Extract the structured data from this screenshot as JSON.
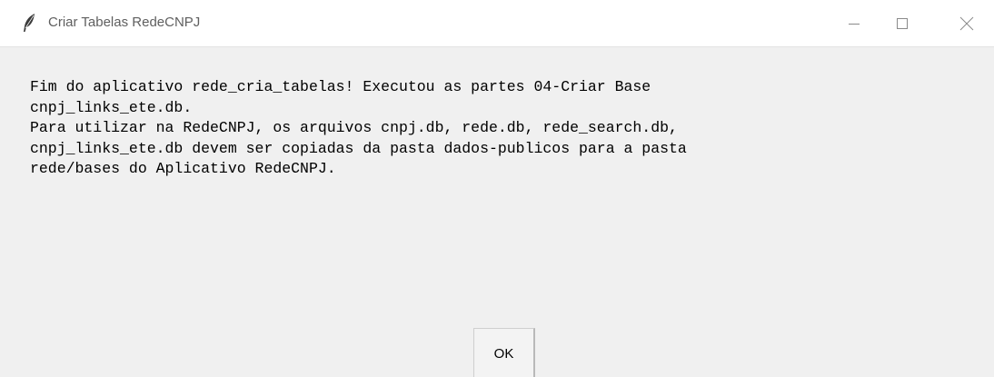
{
  "window": {
    "title": "Criar Tabelas RedeCNPJ",
    "icon": "feather-icon",
    "controls": {
      "minimize_icon": "minimize-icon",
      "maximize_icon": "maximize-icon",
      "close_icon": "close-icon"
    }
  },
  "dialog": {
    "message_lines": [
      "Fim do aplicativo rede_cria_tabelas! Executou as partes 04-Criar Base",
      "cnpj_links_ete.db.",
      "Para utilizar na RedeCNPJ, os arquivos cnpj.db, rede.db, rede_search.db,",
      "cnpj_links_ete.db devem ser copiadas da pasta dados-publicos para a pasta",
      "rede/bases do Aplicativo RedeCNPJ."
    ],
    "ok_label": "OK"
  },
  "colors": {
    "background": "#f0f0f0",
    "titlebar": "#ffffff",
    "title_text": "#5f5f5f",
    "message_text": "#000000"
  }
}
